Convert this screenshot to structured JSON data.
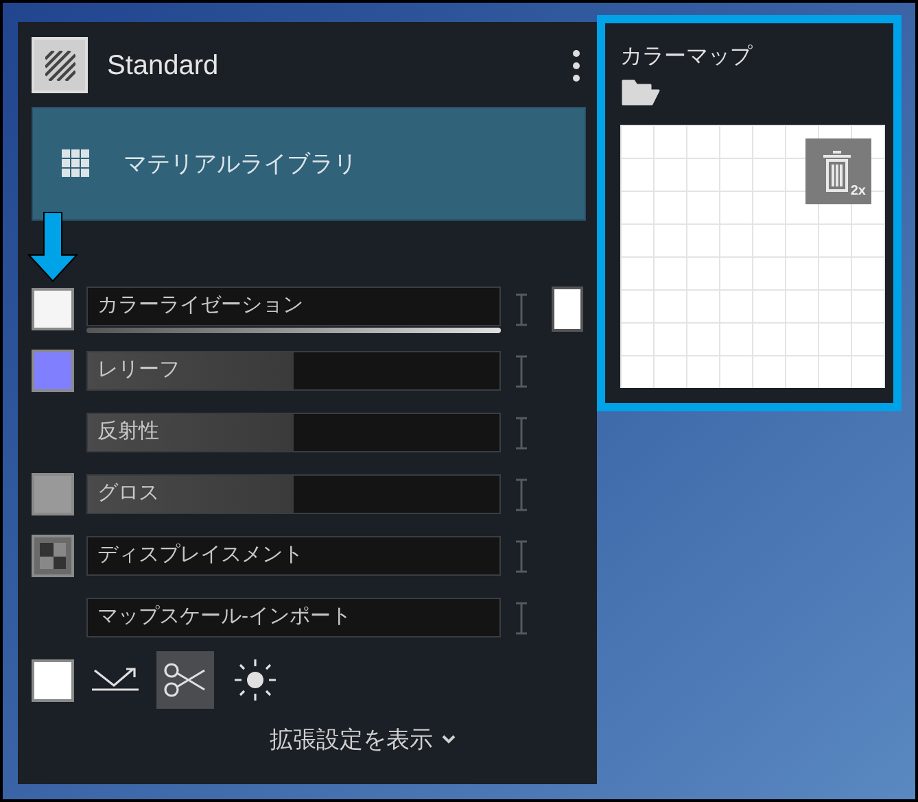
{
  "material": {
    "name": "Standard"
  },
  "library_button": {
    "label": "マテリアルライブラリ"
  },
  "channels": [
    {
      "kind": "gradient",
      "label": "カラーライゼーション",
      "color": "#f5f5f5",
      "end_swatch": {
        "color": "#ffffff"
      }
    },
    {
      "kind": "slider",
      "label": "レリーフ",
      "color": "#8080ff",
      "level": 0.5
    },
    {
      "kind": "slider",
      "label": "反射性",
      "level": 0.5
    },
    {
      "kind": "slider",
      "label": "グロス",
      "color": "#999999",
      "level": 0.5
    },
    {
      "kind": "texture",
      "label": "ディスプレイスメント"
    },
    {
      "kind": "field",
      "label": "マップスケール-インポート"
    }
  ],
  "tools": [
    {
      "kind": "swatch",
      "color": "#ffffff"
    },
    {
      "kind": "reflect",
      "selected": false
    },
    {
      "kind": "scissors",
      "selected": true
    },
    {
      "kind": "sun",
      "selected": false
    }
  ],
  "advanced_link": {
    "label": "拡張設定を表示"
  },
  "color_map": {
    "title": "カラーマップ",
    "delete_badge": "2x"
  }
}
